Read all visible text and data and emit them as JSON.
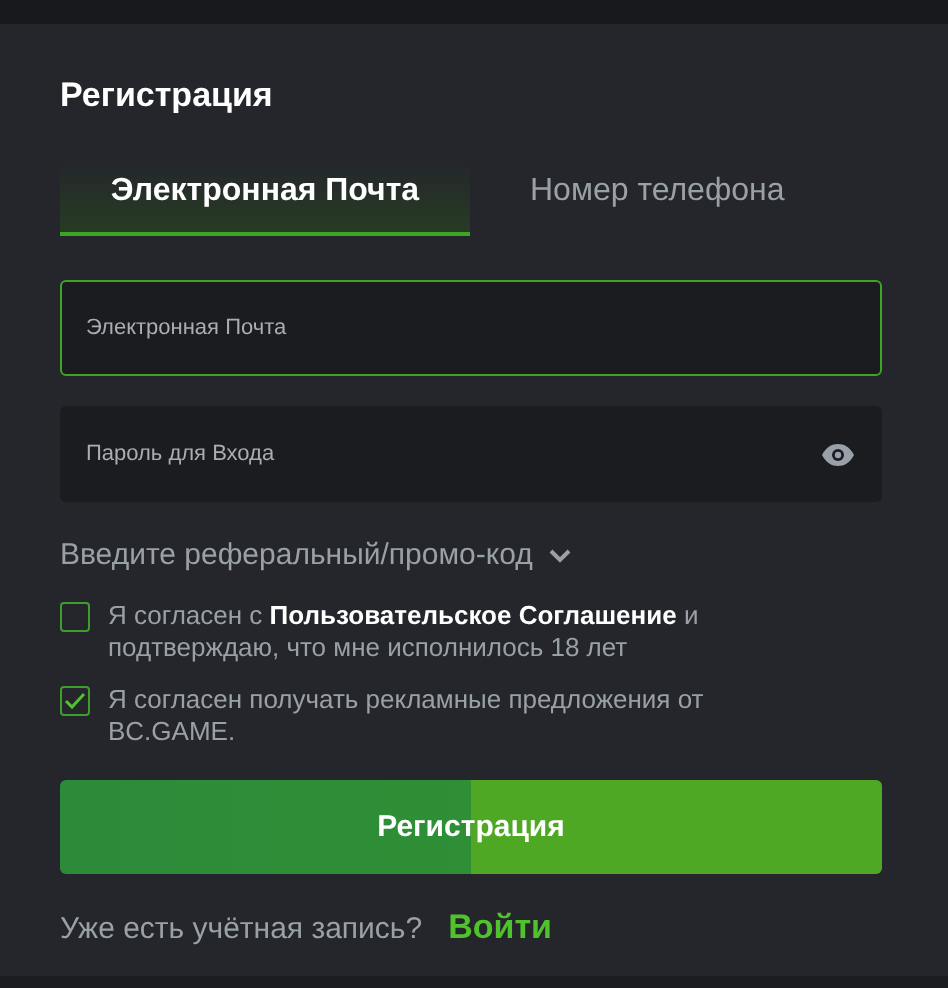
{
  "title": "Регистрация",
  "tabs": [
    {
      "label": "Электронная Почта",
      "selected": true
    },
    {
      "label": "Номер телефона",
      "selected": false
    }
  ],
  "email_field": {
    "placeholder": "Электронная Почта",
    "focused": true
  },
  "password_field": {
    "placeholder": "Пароль для Входа"
  },
  "promo_toggle": {
    "label": "Введите реферальный/промо-код",
    "expanded": false
  },
  "agreements": [
    {
      "text": "Я согласен с **Пользовательское Соглашение** и подтверждаю, что мне исполнилось 18 лет",
      "checked": false
    },
    {
      "text": "Я согласен получать рекламные предложения от BC.GAME.",
      "checked": true
    }
  ],
  "submit_button": "Регистрация",
  "footer": {
    "prompt": "Уже есть учётная запись?",
    "link": "Войти"
  }
}
